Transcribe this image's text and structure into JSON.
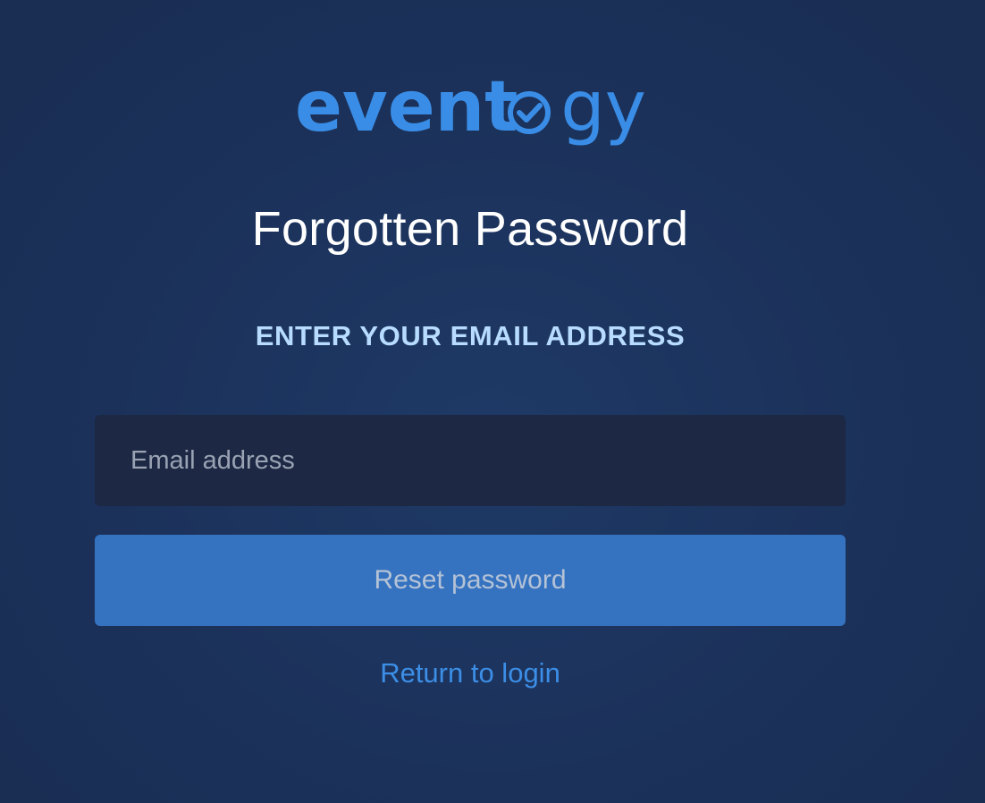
{
  "brand": {
    "logo_text": "eventogy",
    "logo_color": "#3a8de6"
  },
  "form": {
    "title": "Forgotten Password",
    "subtitle": "ENTER YOUR EMAIL ADDRESS",
    "email_placeholder": "Email address",
    "email_value": "",
    "submit_label": "Reset password",
    "return_link": "Return to login"
  },
  "colors": {
    "background": "#1b315a",
    "input_background": "#1d2845",
    "button_background": "#3572c0",
    "subtitle_color": "#b8dcff",
    "link_color": "#3c8ee6"
  }
}
